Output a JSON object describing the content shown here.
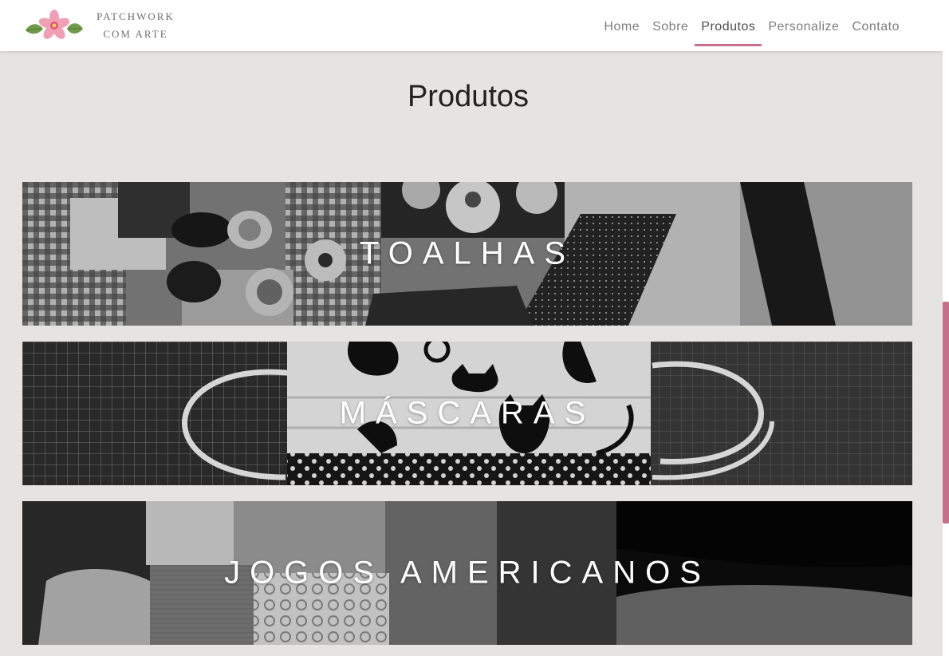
{
  "brand": {
    "line1": "PATCHWORK",
    "line2": "COM ARTE",
    "logo_icon": "flower-icon"
  },
  "nav": {
    "items": [
      {
        "label": "Home"
      },
      {
        "label": "Sobre"
      },
      {
        "label": "Produtos"
      },
      {
        "label": "Personalize"
      },
      {
        "label": "Contato"
      }
    ],
    "active": "Produtos"
  },
  "page": {
    "title": "Produtos"
  },
  "categories": [
    {
      "label": "TOALHAS"
    },
    {
      "label": "MÁSCARAS"
    },
    {
      "label": "JOGOS AMERICANOS"
    }
  ],
  "colors": {
    "accent": "#c8708a",
    "background": "#e6e4e2",
    "navbar": "#ffffff"
  }
}
